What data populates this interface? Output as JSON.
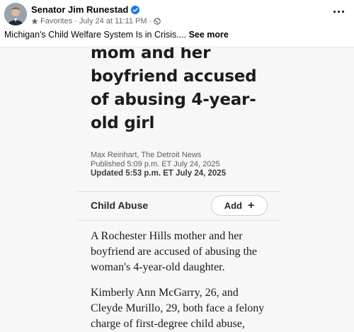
{
  "post": {
    "author": "Senator Jim Runestad",
    "audience": "Favorites",
    "separator": "·",
    "timestamp": "July 24 at 11:11 PM",
    "text": "Michigan's Child Welfare System Is in Crisis.... ",
    "see_more": "See more",
    "icons": [
      "verified-badge-icon",
      "star-icon",
      "globe-icon",
      "more-options-icon"
    ],
    "colors": {
      "verified": "#1877f2",
      "meta": "#65676b"
    }
  },
  "article": {
    "headline_lines": [
      "mom and her",
      "boyfriend accused",
      "of abusing 4-year-",
      "old girl"
    ],
    "author_line": "Max Reinhart, The Detroit News",
    "published": "Published 5:09 p.m. ET July 24, 2025",
    "updated": "Updated 5:53 p.m. ET July 24, 2025",
    "topic": "Child Abuse",
    "add_label": "Add",
    "add_icon": "+",
    "paragraphs": [
      [
        "A Rochester Hills mother and her",
        "boyfriend are accused of abusing the",
        "woman's 4-year-old daughter."
      ],
      [
        "Kimberly Ann McGarry, 26, and",
        "Cleyde Murillo, 29, both face a felony",
        "charge of first-degree child abuse,"
      ]
    ]
  }
}
